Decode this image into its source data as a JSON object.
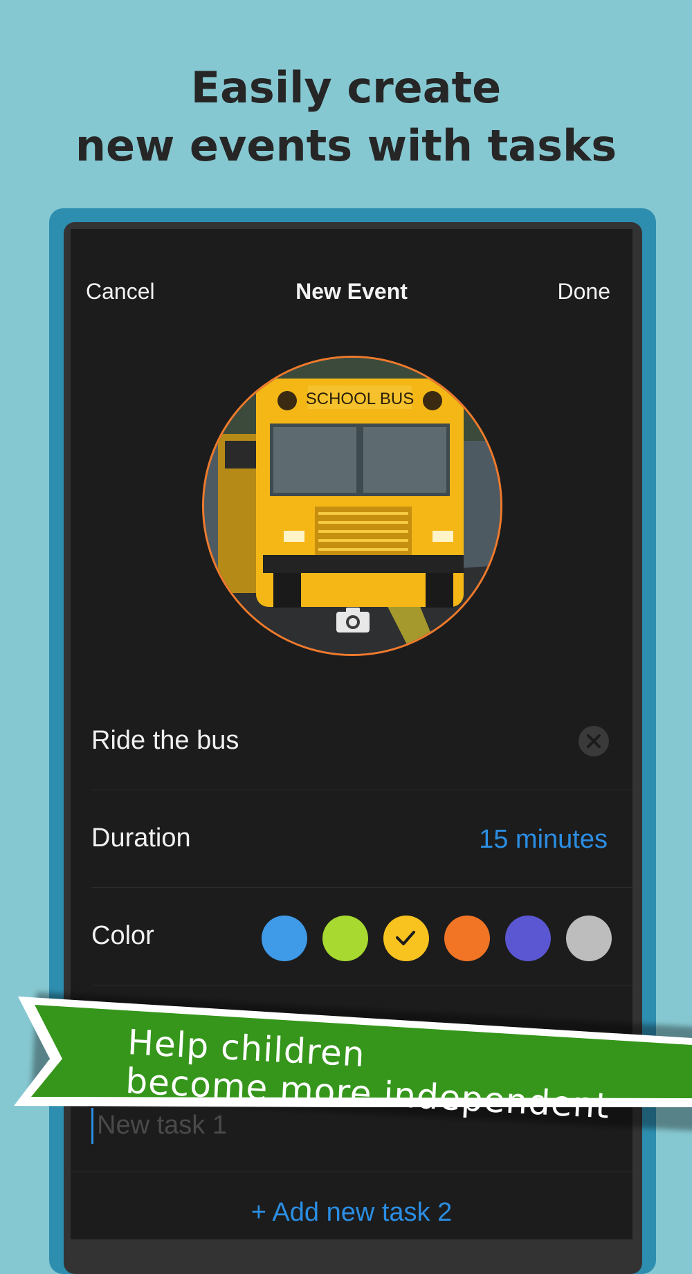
{
  "headline": {
    "line1": "Easily create",
    "line2": "new events with tasks"
  },
  "navbar": {
    "cancel": "Cancel",
    "title": "New Event",
    "done": "Done"
  },
  "event": {
    "name": "Ride the bus",
    "photo_text": "SCHOOL BUS",
    "duration_label": "Duration",
    "duration_value": "15 minutes",
    "color_label": "Color",
    "colors": [
      "#3f9ae8",
      "#a7d930",
      "#f9c31f",
      "#f27425",
      "#5b56d1",
      "#bdbdbd"
    ],
    "selected_color_index": 2
  },
  "tasks": {
    "input_placeholder": "New task 1",
    "add_label": "Add new task 2"
  },
  "banner": {
    "line1": "Help children",
    "line2": "become more independent",
    "color": "#35961b"
  }
}
